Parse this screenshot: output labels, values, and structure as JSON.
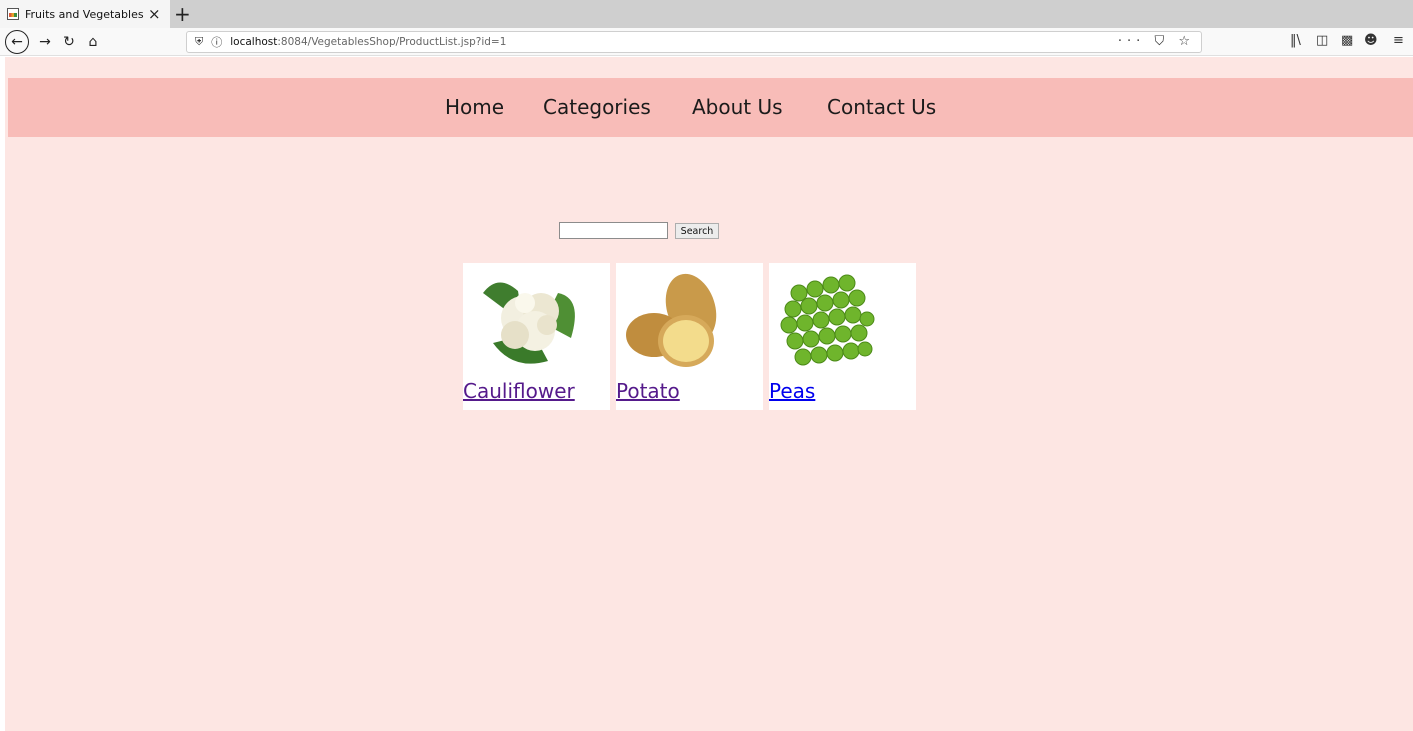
{
  "browser": {
    "tab_title": "Fruits and Vegetables",
    "tab_close": "×",
    "new_tab": "+",
    "url_host": "localhost",
    "url_path": ":8084/VegetablesShop/ProductList.jsp?id=1",
    "page_actions": "··· ⛉ ☆"
  },
  "nav": {
    "items": [
      {
        "label": "Home"
      },
      {
        "label": "Categories"
      },
      {
        "label": "About Us"
      },
      {
        "label": "Contact Us"
      }
    ]
  },
  "search": {
    "value": "",
    "placeholder": "",
    "button_label": "Search"
  },
  "products": [
    {
      "name": "Cauliflower",
      "icon": "cauliflower-image",
      "link_color": "#551a8b"
    },
    {
      "name": "Potato",
      "icon": "potato-image",
      "link_color": "#551a8b"
    },
    {
      "name": "Peas",
      "icon": "peas-image",
      "link_color": "#0000ee"
    }
  ],
  "colors": {
    "page_background": "#fde6e3",
    "menu_background": "#f8bcb8"
  }
}
